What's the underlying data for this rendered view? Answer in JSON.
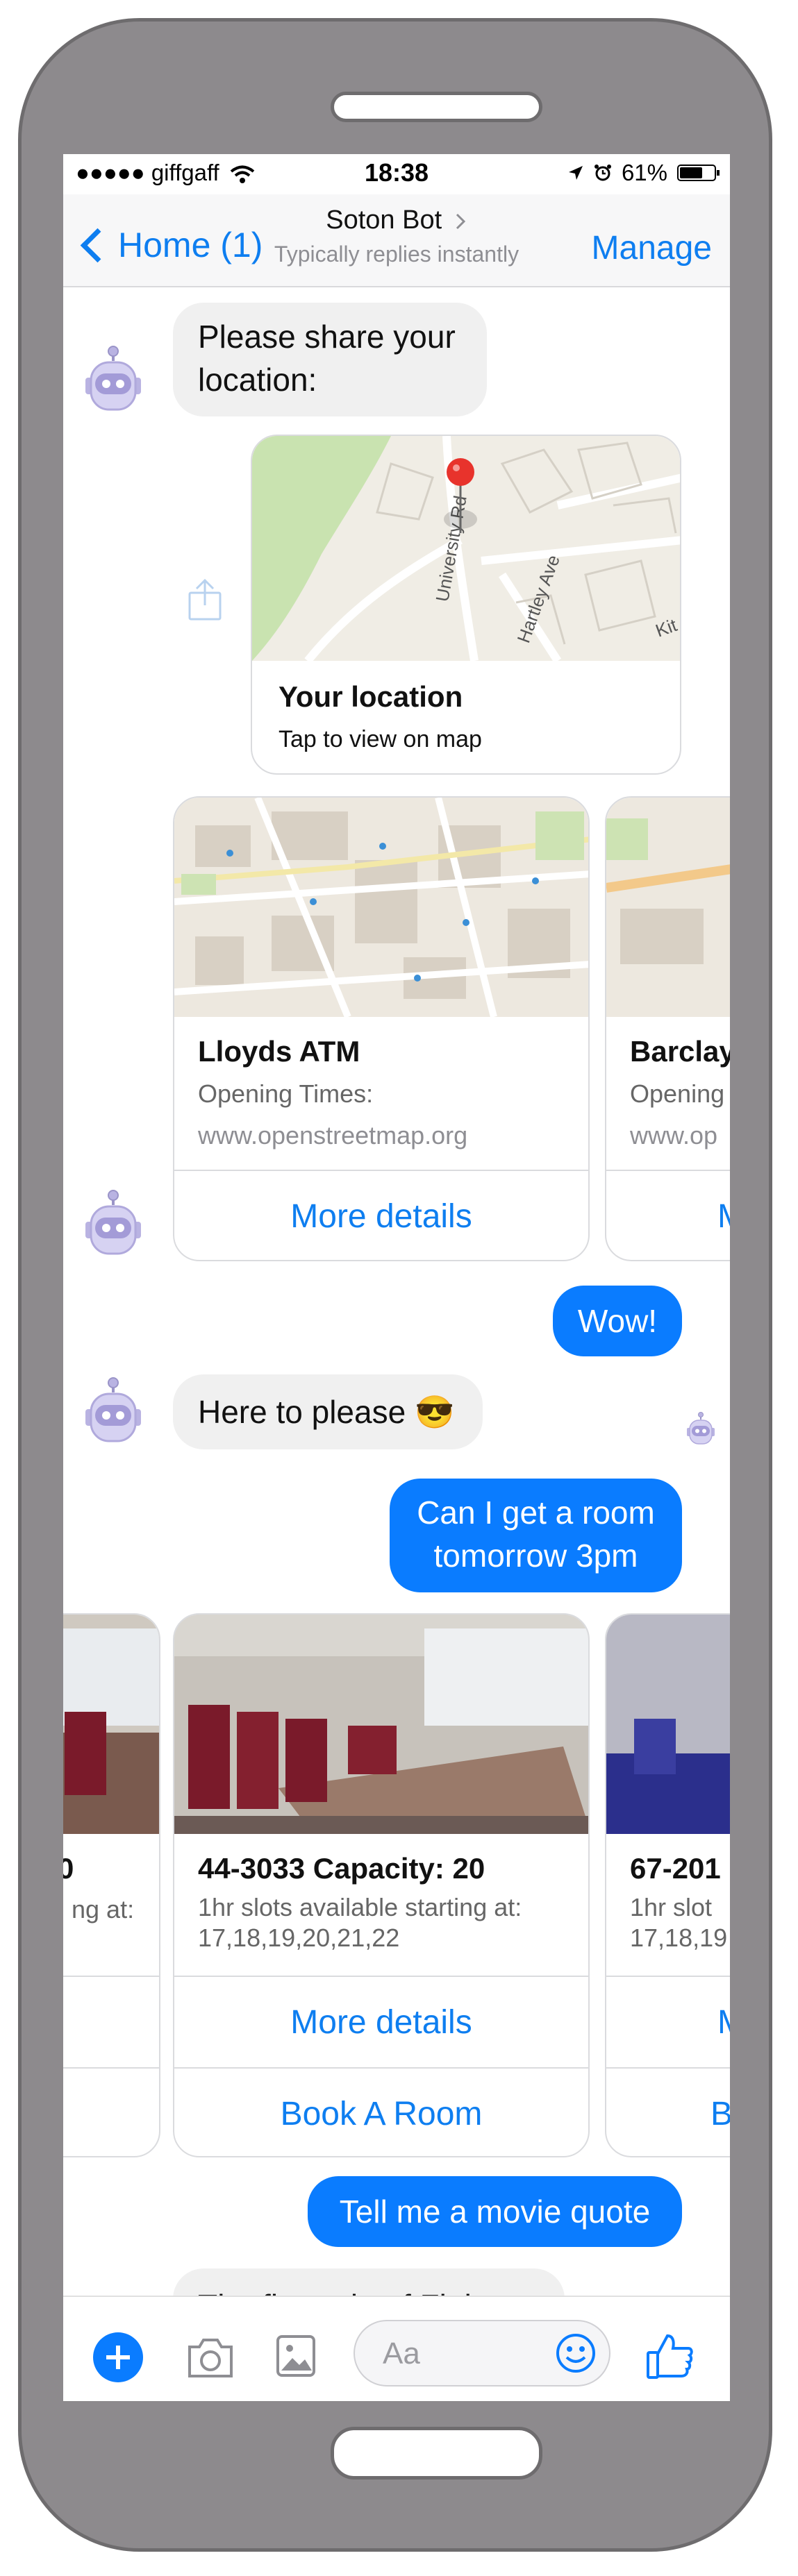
{
  "status_bar": {
    "carrier": "●●●●● giffgaff",
    "time": "18:38",
    "battery": "61%"
  },
  "header": {
    "back_label": "Home (1)",
    "title": "Soton Bot",
    "subtitle": "Typically replies instantly",
    "manage_label": "Manage"
  },
  "messages": {
    "share_prompt": "Please share your location:",
    "location_card": {
      "title": "Your location",
      "subtitle": "Tap to view on map",
      "map_labels": [
        "University Rd",
        "Hartley Ave",
        "Kit"
      ]
    },
    "place_cards": [
      {
        "title": "Lloyds ATM",
        "subtitle": "Opening Times:",
        "source": "www.openstreetmap.org",
        "button": "More details"
      },
      {
        "title": "Barclay",
        "subtitle": "Opening",
        "source": "www.op",
        "button": "M"
      }
    ],
    "user_wow": "Wow!",
    "bot_please": "Here to please 😎",
    "user_room_request": "Can I get a room tomorrow 3pm",
    "room_cards": [
      {
        "title": "0",
        "subtitle": "ng at:",
        "button_details": "",
        "button_book": ""
      },
      {
        "title": "44-3033 Capacity: 20",
        "subtitle": "1hr slots available starting at: 17,18,19,20,21,22",
        "button_details": "More details",
        "button_book": "Book A Room"
      },
      {
        "title": "67-201",
        "subtitle": "1hr slot 17,18,19",
        "button_details": "M",
        "button_book": "B"
      }
    ],
    "user_movie": "Tell me a movie quote",
    "bot_fight_partial": "The first rule of Fight"
  },
  "composer": {
    "placeholder": "Aa"
  },
  "colors": {
    "messenger_blue": "#0a7cff",
    "incoming_bubble": "#f0f0f0",
    "phone_frame": "#8d8a8d"
  },
  "icons": [
    "wifi-icon",
    "location-arrow-icon",
    "alarm-icon",
    "battery-icon",
    "chevron-left-icon",
    "chevron-right-icon",
    "bot-avatar-icon",
    "share-icon",
    "map-pin-icon",
    "plus-icon",
    "camera-icon",
    "image-icon",
    "smiley-icon",
    "thumbs-up-icon"
  ]
}
